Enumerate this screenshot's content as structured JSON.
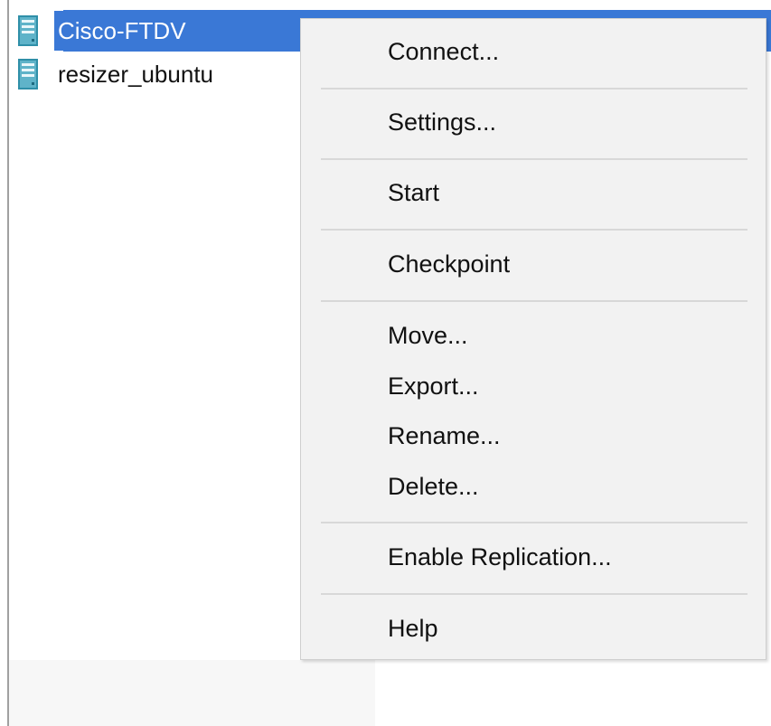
{
  "vm_list": {
    "items": [
      {
        "name": "Cisco-FTDV",
        "selected": true,
        "icon": "server-vm-icon"
      },
      {
        "name": "resizer_ubuntu",
        "selected": false,
        "icon": "server-vm-icon"
      }
    ]
  },
  "context_menu": {
    "connect": "Connect...",
    "settings": "Settings...",
    "start": "Start",
    "checkpoint": "Checkpoint",
    "move": "Move...",
    "export": "Export...",
    "rename": "Rename...",
    "delete": "Delete...",
    "enable_replication": "Enable Replication...",
    "help": "Help"
  },
  "colors": {
    "selection": "#3a78d6",
    "menu_background": "#f2f2f2",
    "icon_teal": "#2f8fa8"
  }
}
